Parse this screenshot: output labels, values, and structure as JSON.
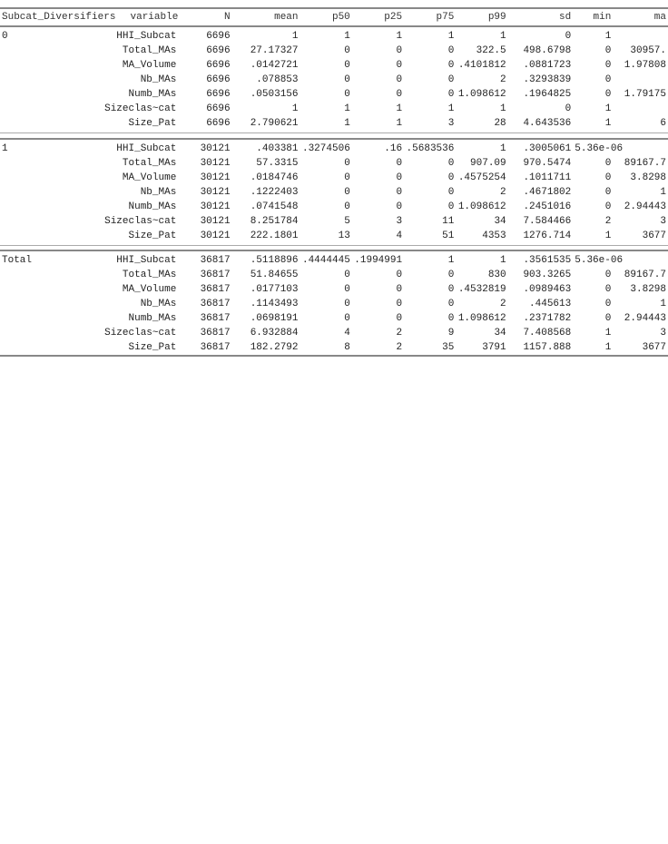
{
  "headers": {
    "subcat": "Subcat_Diversifiers",
    "variable": "variable",
    "n": "N",
    "mean": "mean",
    "p50": "p50",
    "p25": "p25",
    "p75": "p75",
    "p99": "p99",
    "sd": "sd",
    "min": "min",
    "max": "ma"
  },
  "groups": [
    {
      "label": "0",
      "rows": [
        {
          "variable": "HHI_Subcat",
          "n": "6696",
          "mean": "1",
          "p50": "1",
          "p25": "1",
          "p75": "1",
          "p99": "1",
          "sd": "0",
          "min": "1",
          "max": ""
        },
        {
          "variable": "Total_MAs",
          "n": "6696",
          "mean": "27.17327",
          "p50": "0",
          "p25": "0",
          "p75": "0",
          "p99": "322.5",
          "sd": "498.6798",
          "min": "0",
          "max": "30957."
        },
        {
          "variable": "MA_Volume",
          "n": "6696",
          "mean": ".0142721",
          "p50": "0",
          "p25": "0",
          "p75": "0",
          "p99": ".4101812",
          "sd": ".0881723",
          "min": "0",
          "max": "1.97808"
        },
        {
          "variable": "Nb_MAs",
          "n": "6696",
          "mean": ".078853",
          "p50": "0",
          "p25": "0",
          "p75": "0",
          "p99": "2",
          "sd": ".3293839",
          "min": "0",
          "max": ""
        },
        {
          "variable": "Numb_MAs",
          "n": "6696",
          "mean": ".0503156",
          "p50": "0",
          "p25": "0",
          "p75": "0",
          "p99": "1.098612",
          "sd": ".1964825",
          "min": "0",
          "max": "1.79175"
        },
        {
          "variable": "Sizeclas~cat",
          "n": "6696",
          "mean": "1",
          "p50": "1",
          "p25": "1",
          "p75": "1",
          "p99": "1",
          "sd": "0",
          "min": "1",
          "max": ""
        },
        {
          "variable": "Size_Pat",
          "n": "6696",
          "mean": "2.790621",
          "p50": "1",
          "p25": "1",
          "p75": "3",
          "p99": "28",
          "sd": "4.643536",
          "min": "1",
          "max": "6"
        }
      ]
    },
    {
      "label": "1",
      "rows": [
        {
          "variable": "HHI_Subcat",
          "n": "30121",
          "mean": ".403381",
          "p50": ".3274506",
          "p25": ".16",
          "p75": ".5683536",
          "p99": "1",
          "sd": ".3005061",
          "min": "5.36e-06",
          "max": ""
        },
        {
          "variable": "Total_MAs",
          "n": "30121",
          "mean": "57.3315",
          "p50": "0",
          "p25": "0",
          "p75": "0",
          "p99": "907.09",
          "sd": "970.5474",
          "min": "0",
          "max": "89167.7"
        },
        {
          "variable": "MA_Volume",
          "n": "30121",
          "mean": ".0184746",
          "p50": "0",
          "p25": "0",
          "p75": "0",
          "p99": ".4575254",
          "sd": ".1011711",
          "min": "0",
          "max": "3.8298"
        },
        {
          "variable": "Nb_MAs",
          "n": "30121",
          "mean": ".1222403",
          "p50": "0",
          "p25": "0",
          "p75": "0",
          "p99": "2",
          "sd": ".4671802",
          "min": "0",
          "max": "1"
        },
        {
          "variable": "Numb_MAs",
          "n": "30121",
          "mean": ".0741548",
          "p50": "0",
          "p25": "0",
          "p75": "0",
          "p99": "1.098612",
          "sd": ".2451016",
          "min": "0",
          "max": "2.94443"
        },
        {
          "variable": "Sizeclas~cat",
          "n": "30121",
          "mean": "8.251784",
          "p50": "5",
          "p25": "3",
          "p75": "11",
          "p99": "34",
          "sd": "7.584466",
          "min": "2",
          "max": "3"
        },
        {
          "variable": "Size_Pat",
          "n": "30121",
          "mean": "222.1801",
          "p50": "13",
          "p25": "4",
          "p75": "51",
          "p99": "4353",
          "sd": "1276.714",
          "min": "1",
          "max": "3677"
        }
      ]
    },
    {
      "label": "Total",
      "rows": [
        {
          "variable": "HHI_Subcat",
          "n": "36817",
          "mean": ".5118896",
          "p50": ".4444445",
          "p25": ".1994991",
          "p75": "1",
          "p99": "1",
          "sd": ".3561535",
          "min": "5.36e-06",
          "max": ""
        },
        {
          "variable": "Total_MAs",
          "n": "36817",
          "mean": "51.84655",
          "p50": "0",
          "p25": "0",
          "p75": "0",
          "p99": "830",
          "sd": "903.3265",
          "min": "0",
          "max": "89167.7"
        },
        {
          "variable": "MA_Volume",
          "n": "36817",
          "mean": ".0177103",
          "p50": "0",
          "p25": "0",
          "p75": "0",
          "p99": ".4532819",
          "sd": ".0989463",
          "min": "0",
          "max": "3.8298"
        },
        {
          "variable": "Nb_MAs",
          "n": "36817",
          "mean": ".1143493",
          "p50": "0",
          "p25": "0",
          "p75": "0",
          "p99": "2",
          "sd": ".445613",
          "min": "0",
          "max": "1"
        },
        {
          "variable": "Numb_MAs",
          "n": "36817",
          "mean": ".0698191",
          "p50": "0",
          "p25": "0",
          "p75": "0",
          "p99": "1.098612",
          "sd": ".2371782",
          "min": "0",
          "max": "2.94443"
        },
        {
          "variable": "Sizeclas~cat",
          "n": "36817",
          "mean": "6.932884",
          "p50": "4",
          "p25": "2",
          "p75": "9",
          "p99": "34",
          "sd": "7.408568",
          "min": "1",
          "max": "3"
        },
        {
          "variable": "Size_Pat",
          "n": "36817",
          "mean": "182.2792",
          "p50": "8",
          "p25": "2",
          "p75": "35",
          "p99": "3791",
          "sd": "1157.888",
          "min": "1",
          "max": "3677"
        }
      ]
    }
  ]
}
